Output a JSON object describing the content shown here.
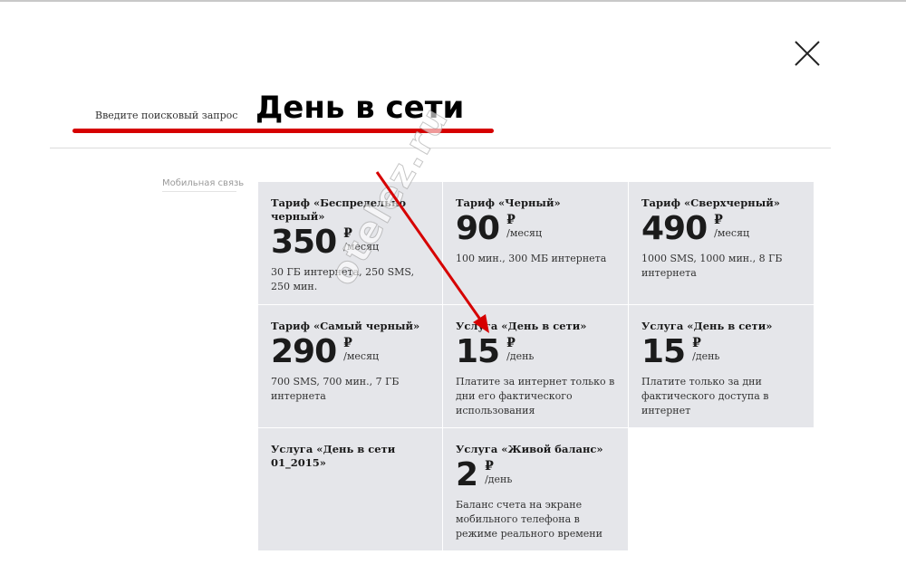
{
  "search": {
    "label": "Введите поисковый запрос",
    "value": "День в сети"
  },
  "close_icon": "close-icon",
  "category": "Мобильная связь",
  "cards": [
    {
      "title": "Тариф «Беспредельно черный»",
      "amount": "350",
      "currency": "₽",
      "period": "/месяц",
      "description": "30 ГБ интернета, 250 SMS, 250 мин."
    },
    {
      "title": "Тариф «Черный»",
      "amount": "90",
      "currency": "₽",
      "period": "/месяц",
      "description": "100 мин., 300 МБ интернета"
    },
    {
      "title": "Тариф «Сверхчерный»",
      "amount": "490",
      "currency": "₽",
      "period": "/месяц",
      "description": "1000 SMS, 1000 мин., 8 ГБ интернета"
    },
    {
      "title": "Тариф «Самый черный»",
      "amount": "290",
      "currency": "₽",
      "period": "/месяц",
      "description": "700 SMS, 700 мин., 7 ГБ интернета"
    },
    {
      "title": "Услуга «День в сети»",
      "amount": "15",
      "currency": "₽",
      "period": "/день",
      "description": "Платите за интернет только в дни его фактического использования"
    },
    {
      "title": "Услуга «День в сети»",
      "amount": "15",
      "currency": "₽",
      "period": "/день",
      "description": "Платите только за дни фактического доступа в интернет"
    },
    {
      "title": "Услуга «День в сети 01_2015»",
      "amount": "",
      "currency": "",
      "period": "",
      "description": ""
    },
    {
      "title": "Услуга «Живой баланс»",
      "amount": "2",
      "currency": "₽",
      "period": "/день",
      "description": "Баланс счета на экране мобильного телефона в режиме реального времени"
    }
  ],
  "watermark": "otelez.ru",
  "colors": {
    "accent_red": "#d60000",
    "card_bg": "#e5e6ea"
  }
}
